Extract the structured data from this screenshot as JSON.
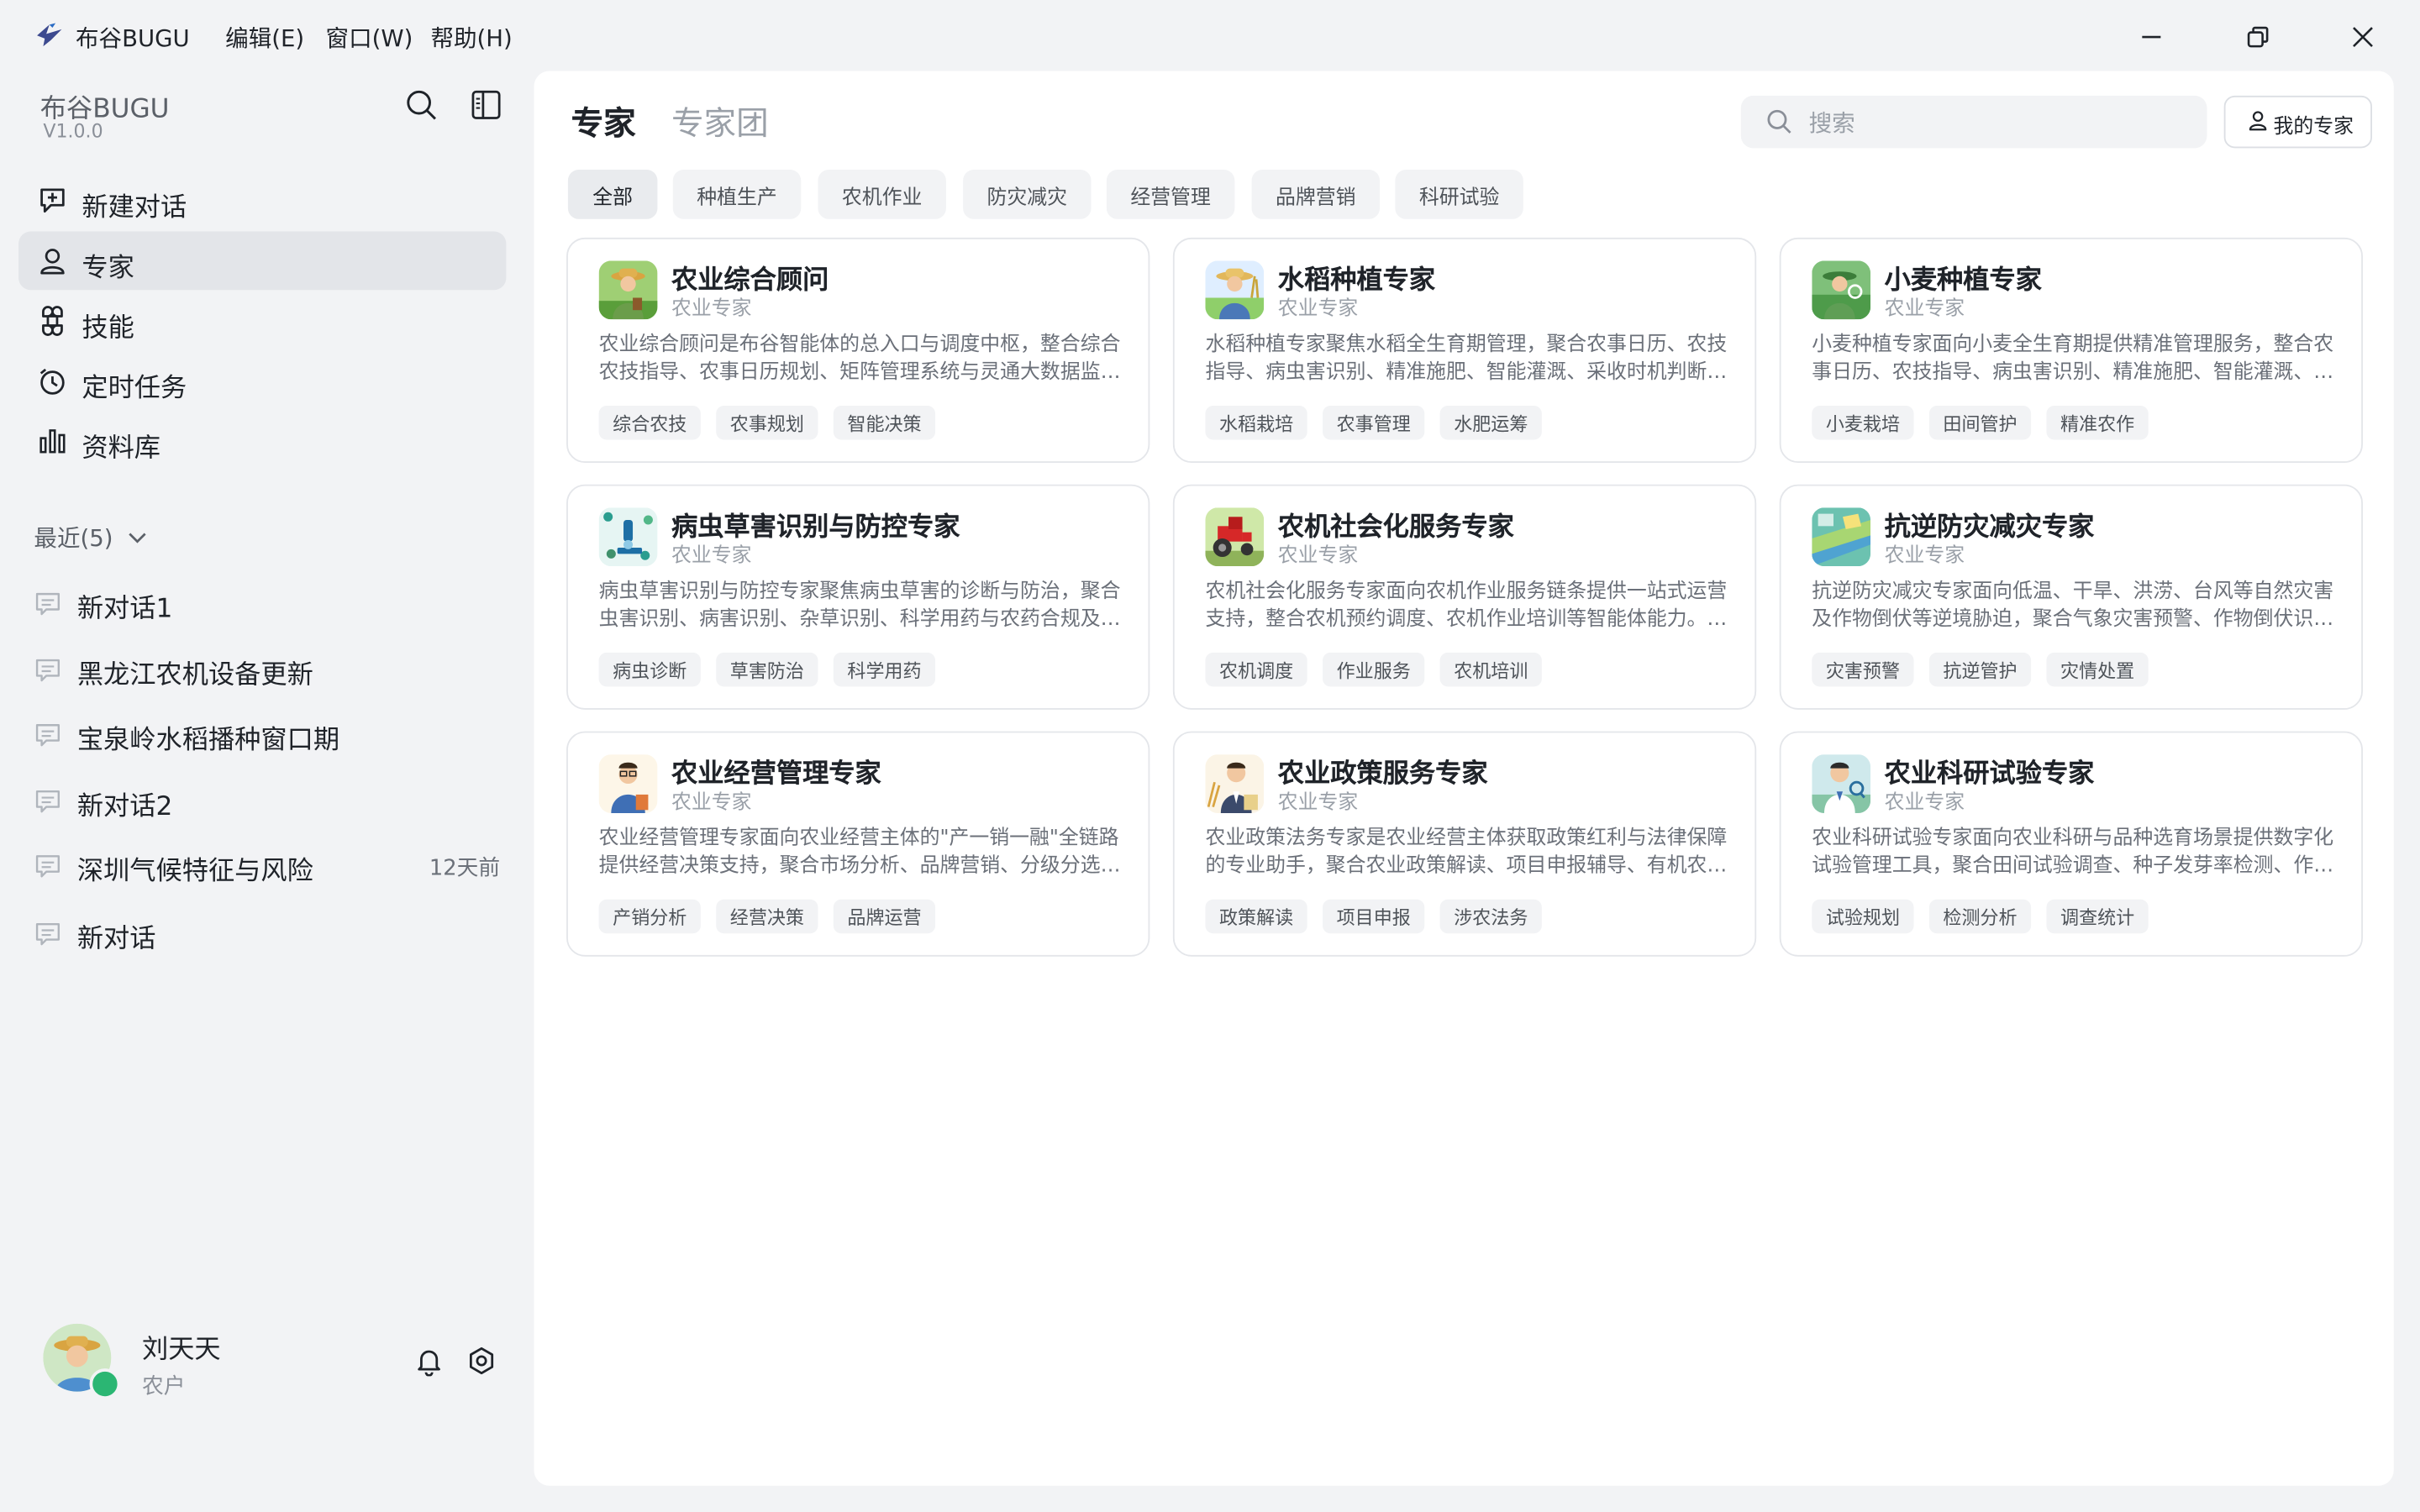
{
  "titlebar": {
    "app_name": "布谷BUGU",
    "menus": [
      "编辑(E)",
      "窗口(W)",
      "帮助(H)"
    ]
  },
  "sidebar": {
    "brand": "布谷BUGU",
    "version": "V1.0.0",
    "nav": [
      {
        "label": "新建对话",
        "icon": "new-chat-icon"
      },
      {
        "label": "专家",
        "icon": "user-icon"
      },
      {
        "label": "技能",
        "icon": "command-icon"
      },
      {
        "label": "定时任务",
        "icon": "clock-icon"
      },
      {
        "label": "资料库",
        "icon": "bar-chart-icon"
      }
    ],
    "recent_label": "最近(5)",
    "recent": [
      {
        "label": "新对话1",
        "time": ""
      },
      {
        "label": "黑龙江农机设备更新",
        "time": ""
      },
      {
        "label": "宝泉岭水稻播种窗口期",
        "time": ""
      },
      {
        "label": "新对话2",
        "time": ""
      },
      {
        "label": "深圳气候特征与风险",
        "time": "12天前"
      },
      {
        "label": "新对话",
        "time": ""
      }
    ],
    "user": {
      "name": "刘天天",
      "role": "农户"
    }
  },
  "main": {
    "tabs": [
      "专家",
      "专家团"
    ],
    "search_placeholder": "搜索",
    "my_experts_label": "我的专家",
    "filters": [
      "全部",
      "种植生产",
      "农机作业",
      "防灾减灾",
      "经营管理",
      "品牌营销",
      "科研试验"
    ],
    "cards": [
      {
        "title": "农业综合顾问",
        "sub": "农业专家",
        "desc": "农业综合顾问是布谷智能体的总入口与调度中枢，整合综合农技指导、农事日历规划、矩阵管理系统与灵通大数据监测等能力。",
        "tags": [
          "综合农技",
          "农事规划",
          "智能决策"
        ]
      },
      {
        "title": "水稻种植专家",
        "sub": "农业专家",
        "desc": "水稻种植专家聚焦水稻全生育期管理，聚合农事日历、农技指导、病虫害识别、精准施肥、智能灌溉、采收时机判断等能力。",
        "tags": [
          "水稻栽培",
          "农事管理",
          "水肥运筹"
        ]
      },
      {
        "title": "小麦种植专家",
        "sub": "农业专家",
        "desc": "小麦种植专家面向小麦全生育期提供精准管理服务，整合农事日历、农技指导、病虫害识别、精准施肥、智能灌溉、采收判断等能力。",
        "tags": [
          "小麦栽培",
          "田间管护",
          "精准农作"
        ]
      },
      {
        "title": "病虫草害识别与防控专家",
        "sub": "农业专家",
        "desc": "病虫草害识别与防控专家聚焦病虫草害的诊断与防治，聚合虫害识别、病害识别、杂草识别、科学用药与农药合规及安全使用等能力。",
        "tags": [
          "病虫诊断",
          "草害防治",
          "科学用药"
        ]
      },
      {
        "title": "农机社会化服务专家",
        "sub": "农业专家",
        "desc": "农机社会化服务专家面向农机作业服务链条提供一站式运营支持，整合农机预约调度、农机作业培训等智能体能力。在农忙时节保障作业。",
        "tags": [
          "农机调度",
          "作业服务",
          "农机培训"
        ]
      },
      {
        "title": "抗逆防灾减灾专家",
        "sub": "农业专家",
        "desc": "抗逆防灾减灾专家面向低温、干旱、洪涝、台风等自然灾害及作物倒伏等逆境胁迫，聚合气象灾害预警、作物倒伏识别与处置等能力。",
        "tags": [
          "灾害预警",
          "抗逆管护",
          "灾情处置"
        ]
      },
      {
        "title": "农业经营管理专家",
        "sub": "农业专家",
        "desc": "农业经营管理专家面向农业经营主体的\"产一销一融\"全链路提供经营决策支持，聚合市场分析、品牌营销、分级分选与金融服务等能力。",
        "tags": [
          "产销分析",
          "经营决策",
          "品牌运营"
        ]
      },
      {
        "title": "农业政策服务专家",
        "sub": "农业专家",
        "desc": "农业政策法务专家是农业经营主体获取政策红利与法律保障的专业助手，聚合农业政策解读、项目申报辅导、有机农业认证等能力。",
        "tags": [
          "政策解读",
          "项目申报",
          "涉农法务"
        ]
      },
      {
        "title": "农业科研试验专家",
        "sub": "农业专家",
        "desc": "农业科研试验专家面向农业科研与品种选育场景提供数字化试验管理工具，聚合田间试验调查、种子发芽率检测、作物考种等能力。",
        "tags": [
          "试验规划",
          "检测分析",
          "调查统计"
        ]
      }
    ]
  }
}
